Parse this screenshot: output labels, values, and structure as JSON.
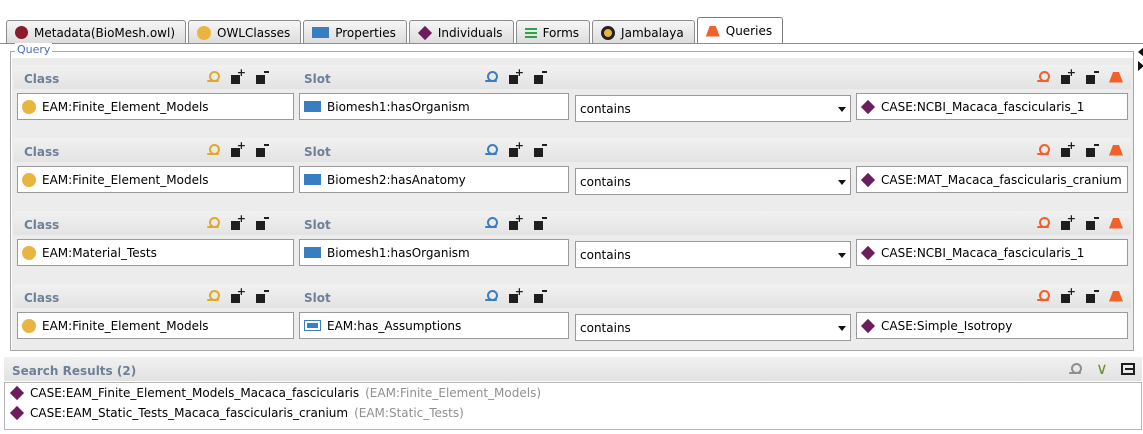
{
  "tabs": [
    {
      "label": "Metadata(BioMesh.owl)",
      "icon": "maroon-circle-icon"
    },
    {
      "label": "OWLClasses",
      "icon": "class-circle-icon"
    },
    {
      "label": "Properties",
      "icon": "property-rect-icon"
    },
    {
      "label": "Individuals",
      "icon": "individual-diamond-icon"
    },
    {
      "label": "Forms",
      "icon": "forms-icon"
    },
    {
      "label": "Jambalaya",
      "icon": "jambalaya-icon"
    },
    {
      "label": "Queries",
      "icon": "query-icon",
      "active": true
    }
  ],
  "query": {
    "title": "Query",
    "class_label": "Class",
    "slot_label": "Slot",
    "rows": [
      {
        "class_value": "EAM:Finite_Element_Models",
        "slot_value": "Biomesh1:hasOrganism",
        "slot_icon": "object-property-icon",
        "operator": "contains",
        "value": "CASE:NCBI_Macaca_fascicularis_1"
      },
      {
        "class_value": "EAM:Finite_Element_Models",
        "slot_value": "Biomesh2:hasAnatomy",
        "slot_icon": "object-property-icon",
        "operator": "contains",
        "value": "CASE:MAT_Macaca_fascicularis_cranium"
      },
      {
        "class_value": "EAM:Material_Tests",
        "slot_value": "Biomesh1:hasOrganism",
        "slot_icon": "object-property-icon",
        "operator": "contains",
        "value": "CASE:NCBI_Macaca_fascicularis_1"
      },
      {
        "class_value": "EAM:Finite_Element_Models",
        "slot_value": "EAM:has_Assumptions",
        "slot_icon": "datatype-property-icon",
        "operator": "contains",
        "value": "CASE:Simple_Isotropy"
      }
    ]
  },
  "results": {
    "title": "Search Results (2)",
    "items": [
      {
        "name": "CASE:EAM_Finite_Element_Models_Macaca_fascicularis",
        "class": "(EAM:Finite_Element_Models)"
      },
      {
        "name": "CASE:EAM_Static_Tests_Macaca_fascicularis_cranium",
        "class": "(EAM:Static_Tests)"
      }
    ]
  },
  "colors": {
    "class_gold": "#e8b640",
    "property_blue": "#3a7ec2",
    "individual_purple": "#6b1e5b",
    "query_orange": "#f0622a",
    "header_label": "#6e7f9a"
  }
}
